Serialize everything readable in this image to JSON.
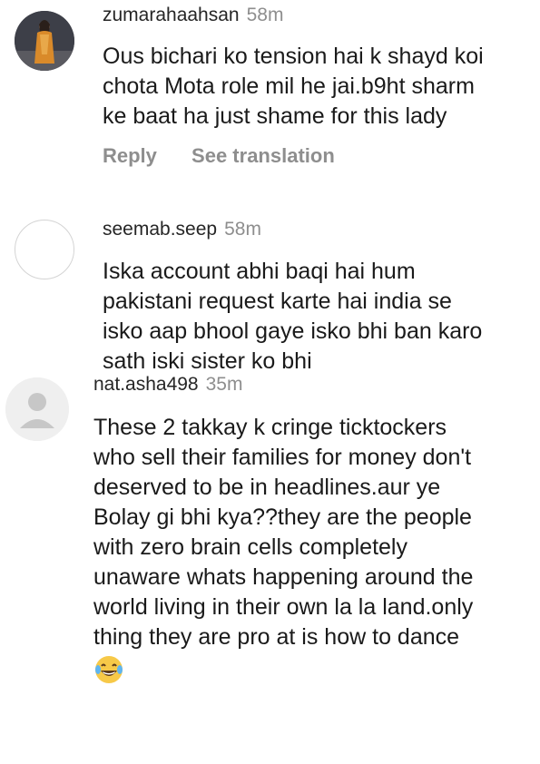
{
  "comments": [
    {
      "username": "zumarahaahsan",
      "time": "58m",
      "avatar": "photo-avatar",
      "lines": [
        "Ous bichari ko tension hai k shayd koi",
        "chota Mota role mil he jai.b9ht sharm",
        "ke baat ha just shame for this lady"
      ],
      "actions": {
        "reply": "Reply",
        "see_translation": "See translation"
      }
    },
    {
      "username": "seemab.seep",
      "time": "58m",
      "avatar": "empty-avatar",
      "lines": [
        "Iska account abhi baqi hai hum",
        "pakistani request karte hai india se",
        "isko aap bhool gaye isko bhi ban karo",
        "sath iski sister ko bhi"
      ]
    },
    {
      "username": "nat.asha498",
      "time": "35m",
      "avatar": "default-user-avatar",
      "lines": [
        "These 2 takkay k cringe ticktockers",
        "who sell their families for money don't",
        "deserved to be in headlines.aur ye",
        "Bolay gi bhi kya??they are the people",
        "with zero brain cells completely",
        "unaware whats happening around the",
        "world living in their own la la land.only",
        "thing they are pro at is how to dance"
      ],
      "emoji": "laughing-with-tears-emoji"
    }
  ],
  "colors": {
    "username": "#262626",
    "muted": "#8e8e8e",
    "text": "#1a1a1a",
    "avatar_gray": "#c7c7c7",
    "emoji_yellow": "#f7c948"
  }
}
